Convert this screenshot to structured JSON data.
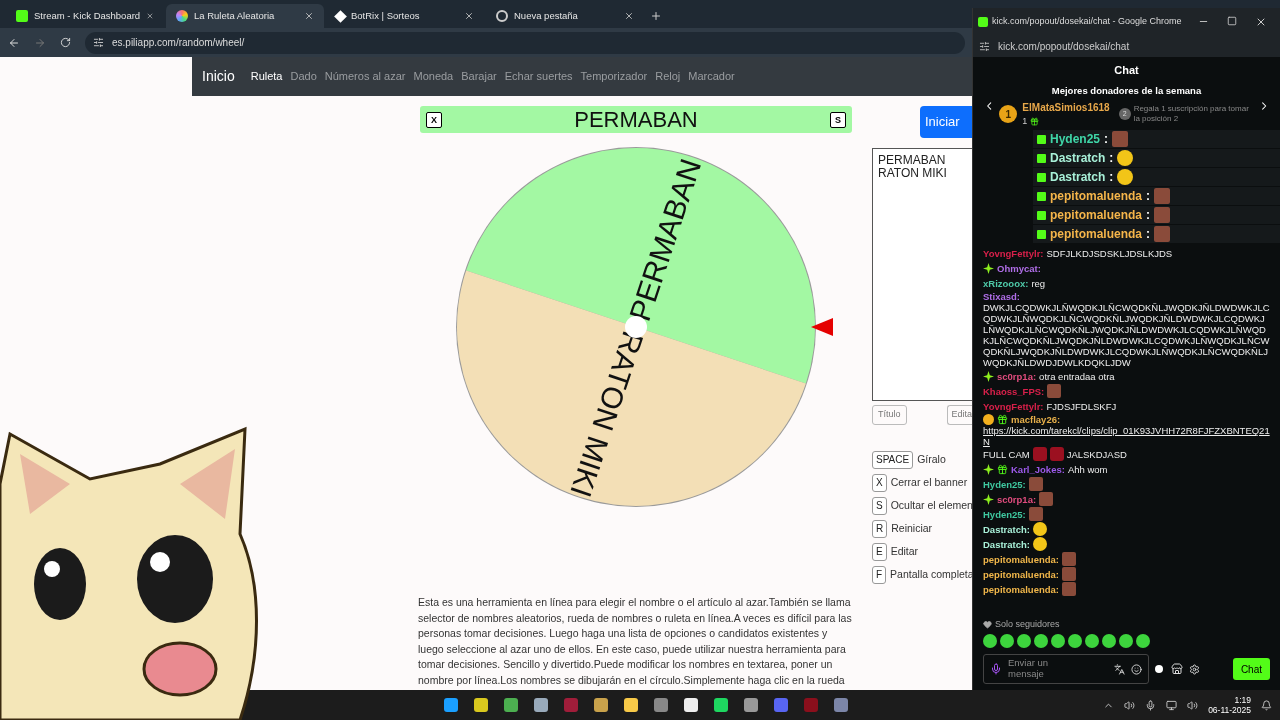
{
  "browser": {
    "tabs": [
      {
        "title": "Stream - Kick Dashboard",
        "selected": false,
        "kind": "kick"
      },
      {
        "title": "La Ruleta Aleatoria",
        "selected": true,
        "kind": "wheel"
      },
      {
        "title": "BotRix | Sorteos",
        "selected": false,
        "kind": "bot"
      },
      {
        "title": "Nueva pestaña",
        "selected": false,
        "kind": "chrome"
      }
    ],
    "address": "es.piliapp.com/random/wheel/"
  },
  "navbar": {
    "brand": "Inicio",
    "links": [
      {
        "label": "Ruleta",
        "selected": true
      },
      {
        "label": "Dado",
        "selected": false
      },
      {
        "label": "Números al azar",
        "selected": false
      },
      {
        "label": "Moneda",
        "selected": false
      },
      {
        "label": "Barajar",
        "selected": false
      },
      {
        "label": "Echar suertes",
        "selected": false
      },
      {
        "label": "Temporizador",
        "selected": false
      },
      {
        "label": "Reloj",
        "selected": false
      },
      {
        "label": "Marcador",
        "selected": false
      }
    ]
  },
  "banner": {
    "close_key": "X",
    "title": "PERMABAN",
    "hide_key": "S"
  },
  "start_button": "Iniciar",
  "wheel": {
    "segments": [
      {
        "label": "PERMABAN",
        "color": "#a3f8a3"
      },
      {
        "label": "RATON MIKI",
        "color": "#f3dfb6"
      }
    ]
  },
  "names_box": {
    "value": "PERMABAN\nRATON MIKI"
  },
  "buttons": [
    "Título",
    "Edita"
  ],
  "shortcuts": [
    {
      "key": "SPACE",
      "label": "Gíralo"
    },
    {
      "key": "X",
      "label": "Cerrar el banner"
    },
    {
      "key": "S",
      "label": "Ocultar el elemen"
    },
    {
      "key": "R",
      "label": "Reiniciar"
    },
    {
      "key": "E",
      "label": "Editar"
    },
    {
      "key": "F",
      "label": "Pantalla completa"
    }
  ],
  "description": "Esta es una herramienta en línea para elegir el nombre o el artículo al azar.También se llama selector de nombres aleatorios, rueda de nombres o ruleta en línea.A veces es difícil para las personas tomar decisiones. Luego haga una lista de opciones o candidatos existentes y luego seleccione al azar uno de ellos. En este caso, puede utilizar nuestra herramienta para tomar decisiones. Sencillo y divertido.Puede modificar los nombres en textarea, poner un nombre por línea.Los nombres se dibujarán en el círculo.Simplemente haga clic en la rueda",
  "chat_window": {
    "title": "kick.com/popout/dosekai/chat - Google Chrome",
    "address": "kick.com/popout/dosekai/chat",
    "header": "Chat",
    "leaderboard": {
      "title": "Mejores donadores de la semana",
      "rank": "1",
      "name": "ElMataSimios1618",
      "count": "1",
      "next_rank": "2",
      "hint": "Regala 1 suscripción para tomar la posición 2"
    },
    "alerts": [
      {
        "user": "Hyden25",
        "separator": ":",
        "color": "#3fd6a8",
        "kind": "photo"
      },
      {
        "user": "Dastratch",
        "separator": ":",
        "color": "#a8f0d8",
        "kind": "smiley"
      },
      {
        "user": "Dastratch",
        "separator": ":",
        "color": "#a8f0d8",
        "kind": "smiley"
      },
      {
        "user": "pepitomaluenda",
        "separator": ":",
        "color": "#f5b54a",
        "kind": "photo"
      },
      {
        "user": "pepitomaluenda",
        "separator": ":",
        "color": "#f5b54a",
        "kind": "photo"
      },
      {
        "user": "pepitomaluenda",
        "separator": ":",
        "color": "#f5b54a",
        "kind": "photo"
      }
    ],
    "messages": [
      {
        "user": "YovngFettylr:",
        "color": "#d8204a",
        "parts": [
          {
            "kind": "text",
            "text": "SDFJLKDJSDSKLJDSLKJDS"
          }
        ]
      },
      {
        "user": "Ohmycat:",
        "color": "#b06ee8",
        "badges": [
          {
            "kind": "sparkle"
          }
        ]
      },
      {
        "user": "xRizooox:",
        "color": "#4ec9a8",
        "parts": [
          {
            "kind": "text",
            "text": "reg"
          }
        ]
      },
      {
        "user": "Stixasd:",
        "color": "#b06ee8",
        "parts": [
          {
            "kind": "text",
            "text": "DWKJLCQDWKJLÑWQDKJLÑCWQDKÑLJWQDKJÑLDWDWKJLCQDWKJLÑWQDKJLÑCWQDKÑLJWQDKJÑLDWDWKJLCQDWKJLÑWQDKJLÑCWQDKÑLJWQDKJÑLDWDWKJLCQDWKJLÑWQDKJLÑCWQDKÑLJWQDKJÑLDWDWKJLCQDWKJLÑWQDKJLÑCWQDKÑLJWQDKJÑLDWDWKJLCQDWKJLÑWQDKJLÑCWQDKÑLJWQDKJÑLDWDJDWLKDQKLJDW"
          }
        ]
      },
      {
        "user": "sc0rp1a:",
        "color": "#e04c7e",
        "badges": [
          {
            "kind": "sparkle"
          }
        ],
        "parts": [
          {
            "kind": "text",
            "text": "otra entradaa otra"
          }
        ]
      },
      {
        "user": "Khaoss_FPS:",
        "color": "#d8204a",
        "parts": [
          {
            "kind": "photo"
          }
        ]
      },
      {
        "user": "YovngFettylr:",
        "color": "#d8204a",
        "parts": [
          {
            "kind": "text",
            "text": "FJDSJFDLSKFJ"
          }
        ]
      },
      {
        "user": "macflay26:",
        "color": "#e8b04a",
        "badges": [
          {
            "kind": "rank"
          },
          {
            "kind": "gift"
          }
        ],
        "parts": [
          {
            "kind": "link",
            "text": "https://kick.com/tarekcl/clips/clip_01K93JVHH72R8FJFZXBNTEQ21N"
          },
          {
            "kind": "text",
            "text": "FULL CAM"
          },
          {
            "kind": "sticker"
          },
          {
            "kind": "sticker"
          },
          {
            "kind": "text",
            "text": "JALSKDJASD"
          }
        ]
      },
      {
        "user": "Karl_Jokes:",
        "color": "#9b59e8",
        "badges": [
          {
            "kind": "sparkle"
          },
          {
            "kind": "gift"
          }
        ],
        "parts": [
          {
            "kind": "text",
            "text": "Ahh wom"
          }
        ]
      },
      {
        "user": "Hyden25:",
        "color": "#3fc9a0",
        "parts": [
          {
            "kind": "photo"
          }
        ]
      },
      {
        "user": "sc0rp1a:",
        "color": "#e04c7e",
        "badges": [
          {
            "kind": "sparkle"
          }
        ],
        "parts": [
          {
            "kind": "photo"
          }
        ]
      },
      {
        "user": "Hyden25:",
        "color": "#3fc9a0",
        "parts": [
          {
            "kind": "photo"
          }
        ]
      },
      {
        "user": "Dastratch:",
        "color": "#a8f0d8",
        "parts": [
          {
            "kind": "smiley"
          }
        ]
      },
      {
        "user": "Dastratch:",
        "color": "#a8f0d8",
        "parts": [
          {
            "kind": "smiley"
          }
        ]
      },
      {
        "user": "pepitomaluenda:",
        "color": "#f0b64a",
        "parts": [
          {
            "kind": "photo"
          }
        ]
      },
      {
        "user": "pepitomaluenda:",
        "color": "#f0b64a",
        "parts": [
          {
            "kind": "photo"
          }
        ]
      },
      {
        "user": "pepitomaluenda:",
        "color": "#f0b64a",
        "parts": [
          {
            "kind": "photo"
          }
        ]
      }
    ],
    "followers_only": "Solo seguidores",
    "placeholder": "Enviar un mensaje",
    "send_button": "Chat"
  },
  "taskbar": {
    "time": "1:19",
    "date": "06-11-2025"
  }
}
